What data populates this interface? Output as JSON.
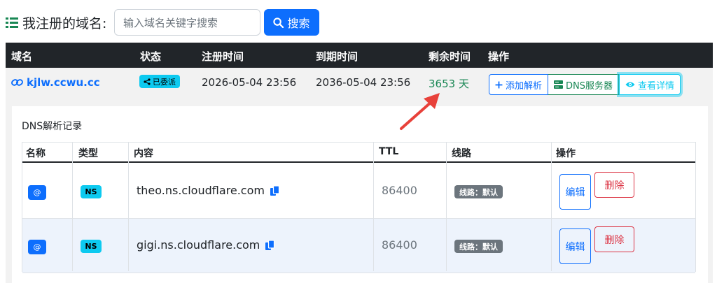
{
  "header": {
    "title": "我注册的域名:",
    "search_placeholder": "输入域名关键字搜索",
    "search_button": "搜索"
  },
  "table": {
    "columns": [
      "域名",
      "状态",
      "注册时间",
      "到期时间",
      "剩余时间",
      "操作"
    ],
    "row": {
      "domain": "kjlw.ccwu.cc",
      "status": "已委派",
      "registered": "2026-05-04 23:56",
      "expires": "2036-05-04 23:56",
      "remaining": "3653 天",
      "actions": {
        "add_record": "添加解析",
        "dns_servers": "DNS服务器",
        "view_details": "查看详情"
      }
    }
  },
  "dns": {
    "title": "DNS解析记录",
    "columns": [
      "名称",
      "类型",
      "内容",
      "TTL",
      "线路",
      "操作"
    ],
    "records": [
      {
        "name": "@",
        "type": "NS",
        "content": "theo.ns.cloudflare.com",
        "ttl": "86400",
        "line": "线路：默认",
        "edit": "编辑",
        "delete": "删除"
      },
      {
        "name": "@",
        "type": "NS",
        "content": "gigi.ns.cloudflare.com",
        "ttl": "86400",
        "line": "线路：默认",
        "edit": "编辑",
        "delete": "删除"
      }
    ]
  },
  "icons": [
    "list-icon",
    "search-icon",
    "link-icon",
    "share-icon",
    "plus-icon",
    "server-icon",
    "eye-icon",
    "copy-icon"
  ],
  "colors": {
    "primary": "#0d6efd",
    "success": "#198754",
    "info": "#0dcaf0",
    "danger": "#dc3545",
    "dark": "#212529",
    "arrow": "#e8413a"
  }
}
